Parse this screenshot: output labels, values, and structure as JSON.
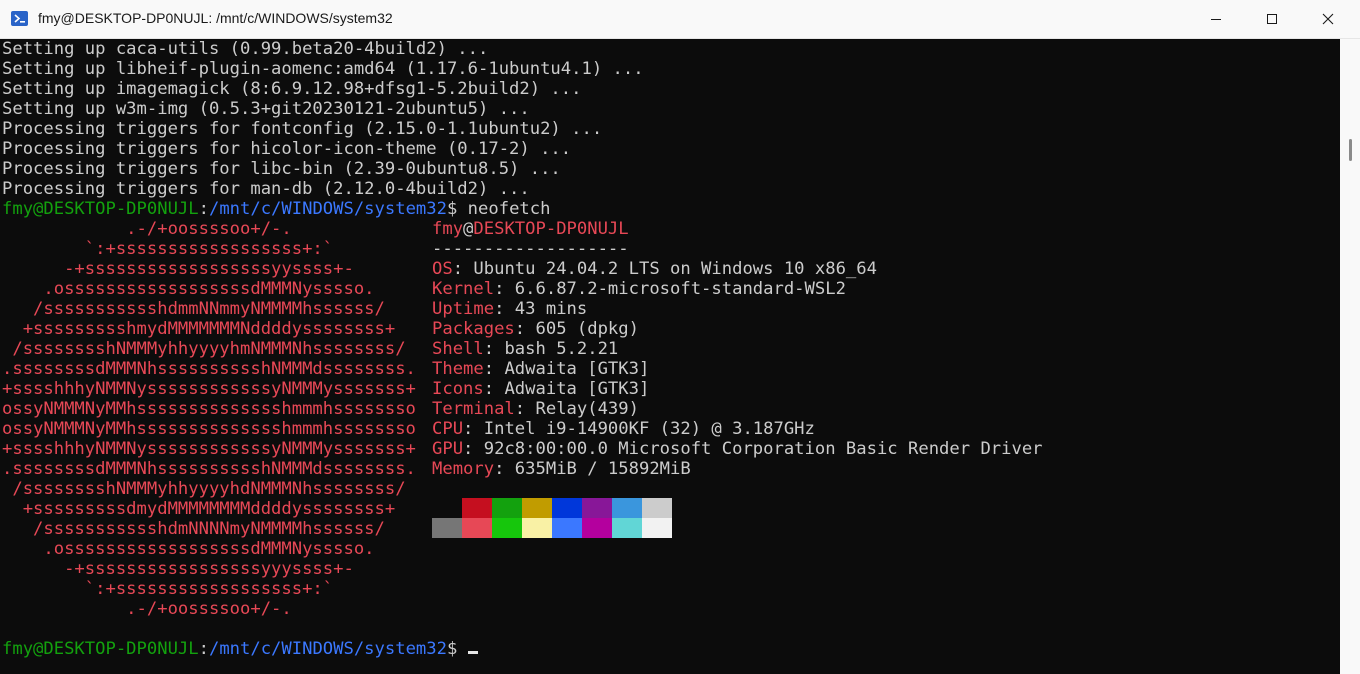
{
  "window": {
    "title": "fmy@DESKTOP-DP0NUJL: /mnt/c/WINDOWS/system32",
    "icon": "terminal-icon"
  },
  "output_lines": [
    "Setting up caca-utils (0.99.beta20-4build2) ...",
    "Setting up libheif-plugin-aomenc:amd64 (1.17.6-1ubuntu4.1) ...",
    "Setting up imagemagick (8:6.9.12.98+dfsg1-5.2build2) ...",
    "Setting up w3m-img (0.5.3+git20230121-2ubuntu5) ...",
    "Processing triggers for fontconfig (2.15.0-1.1ubuntu2) ...",
    "Processing triggers for hicolor-icon-theme (0.17-2) ...",
    "Processing triggers for libc-bin (2.39-0ubuntu8.5) ...",
    "Processing triggers for man-db (2.12.0-4build2) ..."
  ],
  "prompt": {
    "user_host": "fmy@DESKTOP-DP0NUJL",
    "sep": ":",
    "path": "/mnt/c/WINDOWS/system32",
    "dollar": "$",
    "command": " neofetch"
  },
  "logo_lines": [
    "            .-/+oossssoo+/-.",
    "        `:+ssssssssssssssssss+:`",
    "      -+ssssssssssssssssssyyssss+-",
    "    .ossssssssssssssssssdMMMNysssso.",
    "   /ssssssssssshdmmNNmmyNMMMMhssssss/",
    "  +ssssssssshmydMMMMMMMNddddyssssssss+",
    " /sssssssshNMMMyhhyyyyhmNMMMNhssssssss/",
    ".ssssssssdMMMNhsssssssssshNMMMdssssssss.",
    "+sssshhhyNMMNyssssssssssssyNMMMysssssss+",
    "ossyNMMMNyMMhsssssssssssssshmmmhssssssso",
    "ossyNMMMNyMMhsssssssssssssshmmmhssssssso",
    "+sssshhhyNMMNyssssssssssssyNMMMysssssss+",
    ".ssssssssdMMMNhsssssssssshNMMMdssssssss.",
    " /sssssssshNMMMyhhyyyyhdNMMMNhssssssss/",
    "  +sssssssssdmydMMMMMMMMddddyssssssss+",
    "   /ssssssssssshdmNNNNmyNMMMMhssssss/",
    "    .ossssssssssssssssssdMMMNysssso.",
    "      -+sssssssssssssssssyyyssss+-",
    "        `:+ssssssssssssssssss+:`",
    "            .-/+oossssoo+/-."
  ],
  "neofetch": {
    "header_user": "fmy",
    "header_at": "@",
    "header_host": "DESKTOP-DP0NUJL",
    "divider": "-------------------",
    "fields": [
      {
        "key": "OS",
        "value": "Ubuntu 24.04.2 LTS on Windows 10 x86_64"
      },
      {
        "key": "Kernel",
        "value": "6.6.87.2-microsoft-standard-WSL2"
      },
      {
        "key": "Uptime",
        "value": "43 mins"
      },
      {
        "key": "Packages",
        "value": "605 (dpkg)"
      },
      {
        "key": "Shell",
        "value": "bash 5.2.21"
      },
      {
        "key": "Theme",
        "value": "Adwaita [GTK3]"
      },
      {
        "key": "Icons",
        "value": "Adwaita [GTK3]"
      },
      {
        "key": "Terminal",
        "value": "Relay(439)"
      },
      {
        "key": "CPU",
        "value": "Intel i9-14900KF (32) @ 3.187GHz"
      },
      {
        "key": "GPU",
        "value": "92c8:00:00.0 Microsoft Corporation Basic Render Driver"
      },
      {
        "key": "Memory",
        "value": "635MiB / 15892MiB"
      }
    ],
    "key_sep": ": ",
    "palette_row1": [
      "#0c0c0c",
      "#c50f1f",
      "#13a10e",
      "#c19c00",
      "#0037da",
      "#881798",
      "#3a96dd",
      "#cccccc"
    ],
    "palette_row2": [
      "#767676",
      "#e74856",
      "#16c60c",
      "#f9f1a5",
      "#3b78ff",
      "#b4009e",
      "#61d6d6",
      "#f2f2f2"
    ]
  },
  "colors": {
    "user_host": "#13a10e",
    "path": "#3b78ff",
    "logo": "#e74856",
    "text": "#cccccc",
    "background": "#0c0c0c"
  }
}
